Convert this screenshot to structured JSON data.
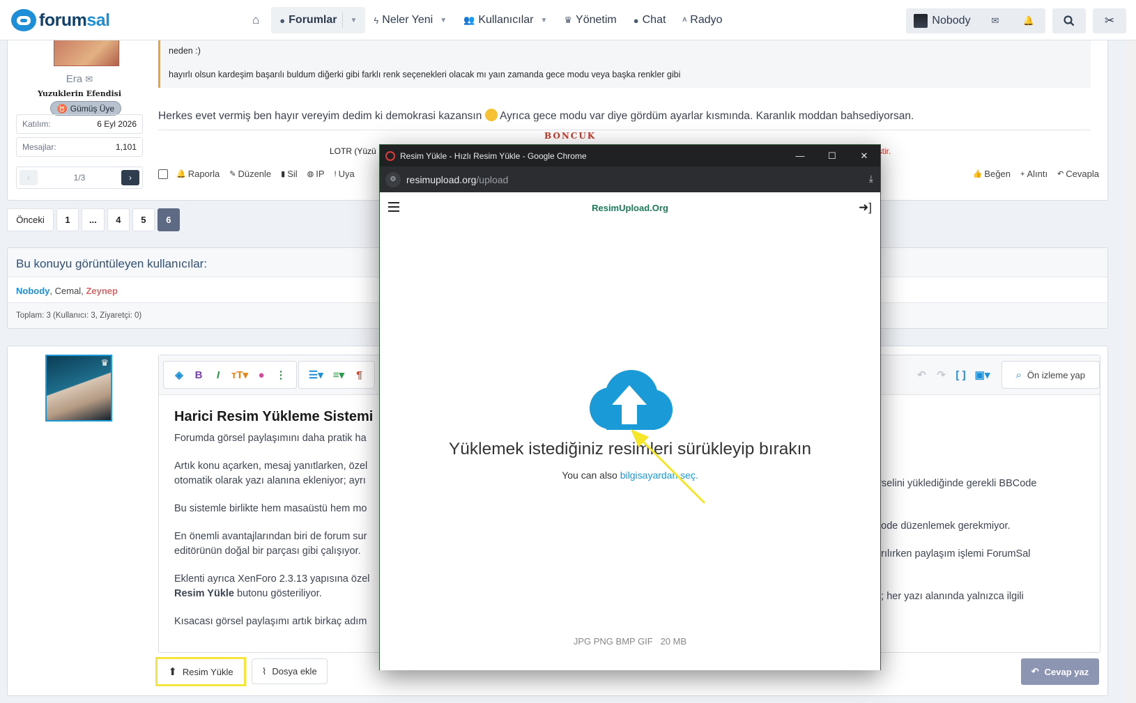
{
  "nav": {
    "logo_a": "forum",
    "logo_b": "sal",
    "items": [
      {
        "label": "",
        "icon": "home-icon"
      },
      {
        "label": "Forumlar",
        "icon": "chat-icon"
      },
      {
        "label": "Neler Yeni",
        "icon": "bolt-icon"
      },
      {
        "label": "Kullanıcılar",
        "icon": "users-icon"
      },
      {
        "label": "Yönetim",
        "icon": "crown-icon"
      },
      {
        "label": "Chat",
        "icon": "chat-icon"
      },
      {
        "label": "Radyo",
        "icon": "radio-icon"
      }
    ],
    "user": "Nobody"
  },
  "post": {
    "username": "Era",
    "user_title": "Yuzuklerin Efendisi",
    "badge": "Gümüş Üye",
    "stats": [
      {
        "label": "Katılım:",
        "value": "6 Eyl 2026"
      },
      {
        "label": "Mesajlar:",
        "value": "1,101"
      }
    ],
    "pager": "1/3",
    "quote_line1": "neden :)",
    "quote_line2": "hayırlı olsun kardeşim başarılı buldum diğerki gibi farklı renk seçenekleri olacak mı yaın zamanda gece modu veya başka renkler gibi",
    "body_a": "Herkes evet vermiş ben hayır vereyim dedim ki demokrasi kazansın",
    "body_b": "Ayrıca gece modu var diye gördüm ayarlar kısmında. Karanlık moddan bahsediyorsan.",
    "sig_head": "BONCUK",
    "sig_lotr": "LOTR (Yüzü",
    "sig_red": "itlenmiştir.",
    "actions": [
      "Raporla",
      "Düzenle",
      "Sil",
      "IP",
      "Uya"
    ],
    "actions_right": [
      "Beğen",
      "Alıntı",
      "Cevapla"
    ]
  },
  "pagination": {
    "prev": "Önceki",
    "pages": [
      "1",
      "...",
      "4",
      "5",
      "6"
    ]
  },
  "viewers": {
    "title": "Bu konuyu görüntüleyen kullanıcılar:",
    "u1": "Nobody",
    "u2": "Cemal",
    "u3": "Zeynep",
    "footer": "Toplam: 3 (Kullanıcı: 3, Ziyaretçi: 0)"
  },
  "editor": {
    "preview": "Ön izleme yap",
    "heading": "Harici Resim Yükleme Sistemi",
    "p1": "Forumda görsel paylaşımını daha pratik ha",
    "p2a": "Artık konu açarken, mesaj yanıtlarken, özel",
    "p2b": "otomatik olarak yazı alanına ekleniyor; ayrı",
    "p2r": "görselini yüklediğinde gerekli BBCode",
    "p3": "Bu sistemle birlikte hem masaüstü hem mo",
    "p3r": "BCode düzenlemek gerekmiyor.",
    "p4a": "En önemli avantajlarından biri de forum sur",
    "p4b": "editörünün doğal bir parçası gibi çalışıyor.",
    "p4r": "ndırılırken paylaşım işlemi ForumSal",
    "p5a": "Eklenti ayrıca XenForo 2.3.13 yapısına özel",
    "p5b_bold": "Resim Yükle",
    "p5b": " butonu gösteriliyor.",
    "p5r": "yor; her yazı alanında yalnızca ilgili",
    "p6": "Kısacası görsel paylaşımı artık birkaç adım",
    "btn_upload": "Resim Yükle",
    "btn_file": "Dosya ekle",
    "btn_reply": "Cevap yaz"
  },
  "popup": {
    "window_title": "Resim Yükle - Hızlı Resim Yükle - Google Chrome",
    "url_domain": "resimupload.org",
    "url_path": "/upload",
    "brand": "ResimUpload.Org",
    "drop_title": "Yüklemek istediğiniz resimleri sürükleyip bırakın",
    "drop_sub": "You can also ",
    "drop_link": "bilgisayardan seç.",
    "formats": "JPG PNG BMP GIF",
    "max_size": "20 MB",
    "accent": "#1a9bd7"
  }
}
